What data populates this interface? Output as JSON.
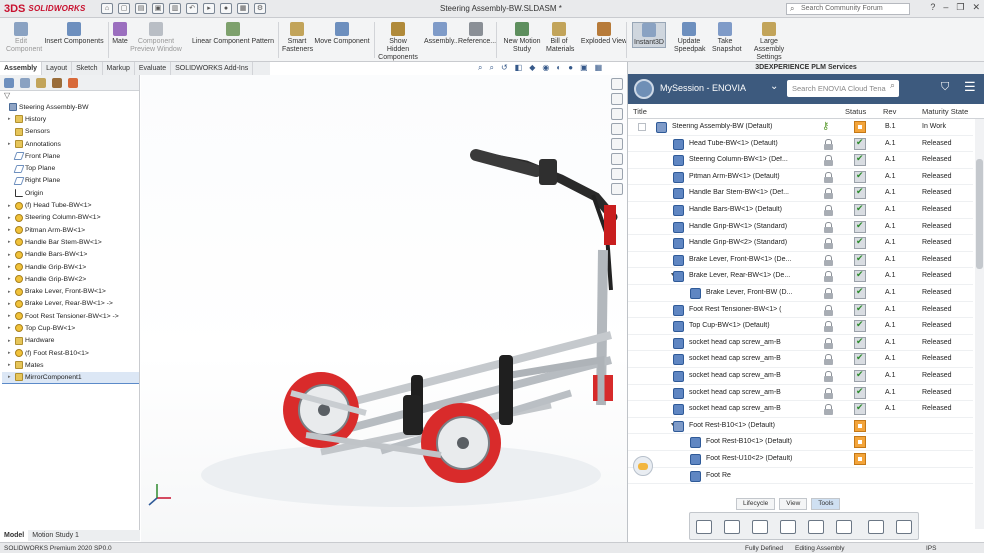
{
  "titlebar": {
    "brand_prefix": "3DS",
    "brand": "SOLIDWORKS",
    "document_title": "Steering Assembly-BW.SLDASM *",
    "search_placeholder": "Search Community Forum"
  },
  "ribbon": {
    "buttons": [
      {
        "label": "Edit\nComponent",
        "dim": true
      },
      {
        "label": "Insert Components",
        "dim": false
      },
      {
        "label": "Mate",
        "dim": false
      },
      {
        "label": "Component\nPreview Window",
        "dim": true
      },
      {
        "label": "Linear Component Pattern",
        "dim": false
      },
      {
        "label": "Smart\nFasteners",
        "dim": false
      },
      {
        "label": "Move Component",
        "dim": false
      },
      {
        "label": "Show Hidden\nComponents",
        "dim": false
      },
      {
        "label": "Assembly...",
        "dim": false
      },
      {
        "label": "Reference...",
        "dim": false
      },
      {
        "label": "New Motion\nStudy",
        "dim": false
      },
      {
        "label": "Bill of\nMaterials",
        "dim": false
      },
      {
        "label": "Exploded View",
        "dim": false
      },
      {
        "label": "Instant3D",
        "dim": false
      },
      {
        "label": "Update\nSpeedpak",
        "dim": false
      },
      {
        "label": "Take\nSnapshot",
        "dim": false
      },
      {
        "label": "Large Assembly\nSettings",
        "dim": false
      }
    ]
  },
  "tabs": [
    "Assembly",
    "Layout",
    "Sketch",
    "Markup",
    "Evaluate",
    "SOLIDWORKS Add-Ins"
  ],
  "tree": {
    "filter": "▽",
    "items": [
      {
        "label": "Steering Assembly-BW",
        "icon": "asm",
        "exp": "",
        "indent": 0
      },
      {
        "label": "History",
        "icon": "folder",
        "exp": "▸",
        "indent": 1
      },
      {
        "label": "Sensors",
        "icon": "folder",
        "exp": "",
        "indent": 1
      },
      {
        "label": "Annotations",
        "icon": "folder",
        "exp": "▸",
        "indent": 1
      },
      {
        "label": "Front Plane",
        "icon": "plane",
        "exp": "",
        "indent": 1
      },
      {
        "label": "Top Plane",
        "icon": "plane",
        "exp": "",
        "indent": 1
      },
      {
        "label": "Right Plane",
        "icon": "plane",
        "exp": "",
        "indent": 1
      },
      {
        "label": "Origin",
        "icon": "origin",
        "exp": "",
        "indent": 1
      },
      {
        "label": "(f) Head Tube-BW<1>",
        "icon": "part",
        "exp": "▸",
        "indent": 1
      },
      {
        "label": "Steering Column-BW<1>",
        "icon": "part",
        "exp": "▸",
        "indent": 1
      },
      {
        "label": "Pitman Arm-BW<1>",
        "icon": "part",
        "exp": "▸",
        "indent": 1
      },
      {
        "label": "Handle Bar Stem-BW<1>",
        "icon": "part",
        "exp": "▸",
        "indent": 1
      },
      {
        "label": "Handle Bars-BW<1>",
        "icon": "part",
        "exp": "▸",
        "indent": 1
      },
      {
        "label": "Handle Grip-BW<1>",
        "icon": "part",
        "exp": "▸",
        "indent": 1
      },
      {
        "label": "Handle Grip-BW<2>",
        "icon": "part",
        "exp": "▸",
        "indent": 1
      },
      {
        "label": "Brake Lever, Front-BW<1>",
        "icon": "part",
        "exp": "▸",
        "indent": 1
      },
      {
        "label": "Brake Lever, Rear-BW<1> ->",
        "icon": "part",
        "exp": "▸",
        "indent": 1
      },
      {
        "label": "Foot Rest Tensioner-BW<1> ->",
        "icon": "part",
        "exp": "▸",
        "indent": 1
      },
      {
        "label": "Top Cup-BW<1>",
        "icon": "part",
        "exp": "▸",
        "indent": 1
      },
      {
        "label": "Hardware",
        "icon": "folder",
        "exp": "▸",
        "indent": 1
      },
      {
        "label": "(f) Foot Rest-B10<1>",
        "icon": "part",
        "exp": "▸",
        "indent": 1
      },
      {
        "label": "Mates",
        "icon": "folder",
        "exp": "▸",
        "indent": 1
      },
      {
        "label": "MirrorComponent1",
        "icon": "folder",
        "exp": "▸",
        "indent": 1,
        "selected": true
      }
    ]
  },
  "bottom_tabs": [
    "Model",
    "Motion Study 1"
  ],
  "statusbar": {
    "product": "SOLIDWORKS Premium 2020 SP0.0",
    "state": "Fully Defined",
    "mode": "Editing Assembly",
    "units": "IPS"
  },
  "plm": {
    "header": "3DEXPERIENCE PLM Services",
    "session": "MySession - ENOVIA",
    "search_placeholder": "Search ENOVIA Cloud Tena",
    "columns": {
      "title": "Title",
      "status": "Status",
      "rev": "Rev",
      "maturity": "Maturity State"
    },
    "rows": [
      {
        "title": "Steering Assembly-BW (Default)",
        "level": 0,
        "exp": "",
        "icon": "asm",
        "lock": "key",
        "status": "orange",
        "rev": "B.1",
        "maturity": "In Work"
      },
      {
        "title": "Head Tube-BW<1> (Default)",
        "level": 1,
        "exp": "",
        "icon": "part",
        "lock": "lock",
        "status": "ok",
        "rev": "A.1",
        "maturity": "Released"
      },
      {
        "title": "Steering Column-BW<1> (Def...",
        "level": 1,
        "exp": "",
        "icon": "part",
        "lock": "lock",
        "status": "ok",
        "rev": "A.1",
        "maturity": "Released"
      },
      {
        "title": "Pitman Arm-BW<1> (Default)",
        "level": 1,
        "exp": "",
        "icon": "part",
        "lock": "lock",
        "status": "ok",
        "rev": "A.1",
        "maturity": "Released"
      },
      {
        "title": "Handle Bar Stem-BW<1> (Def...",
        "level": 1,
        "exp": "",
        "icon": "part",
        "lock": "lock",
        "status": "ok",
        "rev": "A.1",
        "maturity": "Released"
      },
      {
        "title": "Handle Bars-BW<1> (Default)",
        "level": 1,
        "exp": "",
        "icon": "part",
        "lock": "lock",
        "status": "ok",
        "rev": "A.1",
        "maturity": "Released"
      },
      {
        "title": "Handle Grip-BW<1> (Standard)",
        "level": 1,
        "exp": "",
        "icon": "part",
        "lock": "lock",
        "status": "ok",
        "rev": "A.1",
        "maturity": "Released"
      },
      {
        "title": "Handle Grip-BW<2> (Standard)",
        "level": 1,
        "exp": "",
        "icon": "part",
        "lock": "lock",
        "status": "ok",
        "rev": "A.1",
        "maturity": "Released"
      },
      {
        "title": "Brake Lever, Front-BW<1> (De...",
        "level": 1,
        "exp": "",
        "icon": "part",
        "lock": "lock",
        "status": "ok",
        "rev": "A.1",
        "maturity": "Released"
      },
      {
        "title": "Brake Lever, Rear-BW<1> (De...",
        "level": 1,
        "exp": "▾",
        "icon": "part",
        "lock": "lock",
        "status": "ok",
        "rev": "A.1",
        "maturity": "Released"
      },
      {
        "title": "Brake Lever, Front-BW (D...",
        "level": 2,
        "exp": "",
        "icon": "part",
        "lock": "lock",
        "status": "ok",
        "rev": "A.1",
        "maturity": "Released"
      },
      {
        "title": "Foot Rest Tensioner-BW<1> (",
        "level": 1,
        "exp": "",
        "icon": "part",
        "lock": "lock",
        "status": "ok",
        "rev": "A.1",
        "maturity": "Released"
      },
      {
        "title": "Top Cup-BW<1> (Default)",
        "level": 1,
        "exp": "",
        "icon": "part",
        "lock": "lock",
        "status": "ok",
        "rev": "A.1",
        "maturity": "Released"
      },
      {
        "title": "socket head cap screw_am-B",
        "level": 1,
        "exp": "",
        "icon": "part",
        "lock": "lock",
        "status": "ok",
        "rev": "A.1",
        "maturity": "Released"
      },
      {
        "title": "socket head cap screw_am-B",
        "level": 1,
        "exp": "",
        "icon": "part",
        "lock": "lock",
        "status": "ok",
        "rev": "A.1",
        "maturity": "Released"
      },
      {
        "title": "socket head cap screw_am-B",
        "level": 1,
        "exp": "",
        "icon": "part",
        "lock": "lock",
        "status": "ok",
        "rev": "A.1",
        "maturity": "Released"
      },
      {
        "title": "socket head cap screw_am-B",
        "level": 1,
        "exp": "",
        "icon": "part",
        "lock": "lock",
        "status": "ok",
        "rev": "A.1",
        "maturity": "Released"
      },
      {
        "title": "socket head cap screw_am-B",
        "level": 1,
        "exp": "",
        "icon": "part",
        "lock": "lock",
        "status": "ok",
        "rev": "A.1",
        "maturity": "Released"
      },
      {
        "title": "Foot Rest-B10<1> (Default)",
        "level": 1,
        "exp": "▾",
        "icon": "asm",
        "lock": "",
        "status": "orange",
        "rev": "",
        "maturity": ""
      },
      {
        "title": "Foot Rest-B10<1> (Default)",
        "level": 2,
        "exp": "",
        "icon": "part",
        "lock": "",
        "status": "orange",
        "rev": "",
        "maturity": ""
      },
      {
        "title": "Foot Rest-U10<2> (Default)",
        "level": 2,
        "exp": "",
        "icon": "part",
        "lock": "",
        "status": "orange",
        "rev": "",
        "maturity": ""
      },
      {
        "title": "Foot Re",
        "level": 2,
        "exp": "",
        "icon": "part",
        "lock": "",
        "status": "",
        "rev": "",
        "maturity": ""
      }
    ],
    "toolbar_tabs": [
      {
        "label": "Lifecycle",
        "on": false
      },
      {
        "label": "View",
        "on": false
      },
      {
        "label": "Tools",
        "on": true
      }
    ]
  },
  "colors": {
    "accent_red": "#c8102e",
    "plm_bar": "#3d5a7e",
    "frame_red": "#d62a2a"
  }
}
